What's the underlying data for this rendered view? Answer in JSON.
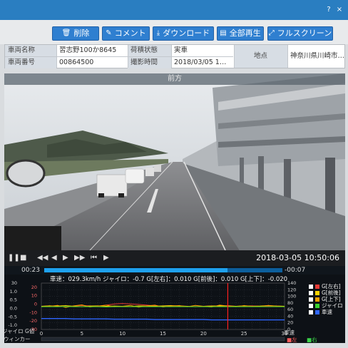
{
  "titlebar": {
    "help_label": "?",
    "close_label": "×"
  },
  "toolbar": {
    "delete": "削除",
    "comment": "コメント",
    "download": "ダウンロード",
    "play_all": "全部再生",
    "fullscreen": "フルスクリーン"
  },
  "info": {
    "vehicle_name_label": "車両名称",
    "vehicle_name": "習志野100か8645",
    "cargo_label": "荷積状態",
    "cargo": "実車",
    "vehicle_no_label": "車両番号",
    "vehicle_no": "00864500",
    "shot_time_label": "撮影時間",
    "shot_time": "2018/03/05 1…",
    "location_label": "地点",
    "location": "神奈川県川崎市…"
  },
  "video": {
    "view_label": "前方"
  },
  "player": {
    "datetime": "2018-03-05 10:50:06",
    "elapsed": "00:23",
    "remaining": "-00:07",
    "progress": 0.77
  },
  "readout": {
    "speed_label": "車速：",
    "speed": "029.3km/h",
    "gyro_label": "ジャイロ：",
    "gyro": "-0.7",
    "glr_label": "G[左右]：",
    "glr": "0.010",
    "gfb_label": "G[前後]：",
    "gfb": "0.010",
    "gud_label": "G[上下]：",
    "gud": "-0.020"
  },
  "legend": [
    {
      "label": "G[左右]",
      "color": "#e53935"
    },
    {
      "label": "G[前後]",
      "color": "#ffd400"
    },
    {
      "label": "G[上下]",
      "color": "#f5a000"
    },
    {
      "label": "ジャイロ",
      "color": "#39d12f"
    },
    {
      "label": "車速",
      "color": "#2f66ff"
    }
  ],
  "graph_labels": {
    "gyro_g": "ジャイロ  G値",
    "winker": "ウィンカー",
    "speed": "車速",
    "left": "左",
    "right": "右"
  },
  "chart_data": {
    "type": "line",
    "x": [
      0,
      1,
      2,
      3,
      4,
      5,
      6,
      7,
      8,
      9,
      10,
      11,
      12,
      13,
      14,
      15,
      16,
      17,
      18,
      19,
      20,
      21,
      22,
      23,
      24,
      25,
      26,
      27,
      28,
      29,
      30
    ],
    "x_ticks": [
      "0",
      "5",
      "10",
      "15",
      "20",
      "25",
      "30"
    ],
    "xlim": [
      0,
      30
    ],
    "y_left_ticks": [
      "30",
      "20",
      "1.0",
      "10",
      "0.5",
      "0",
      "0.0",
      "-10",
      "-0.5",
      "-20",
      "-1.0",
      "-30"
    ],
    "y_right_ticks": [
      "140",
      "120",
      "100",
      "80",
      "60",
      "40",
      "20",
      "0"
    ],
    "ylim_left": [
      -1.0,
      1.0
    ],
    "ylim_right": [
      0,
      140
    ],
    "cursor_x": 23,
    "series": [
      {
        "name": "G[左右]",
        "axis": "left",
        "values": [
          0.0,
          0.02,
          0.0,
          -0.02,
          0.01,
          0.03,
          0.02,
          0.0,
          0.05,
          0.1,
          0.12,
          0.1,
          0.08,
          0.05,
          0.02,
          0.0,
          0.0,
          0.02,
          0.0,
          -0.01,
          0.0,
          0.02,
          0.0,
          0.03,
          0.0,
          0.01,
          0.02,
          0.0,
          0.0,
          0.01,
          0.0
        ]
      },
      {
        "name": "G[前後]",
        "axis": "left",
        "values": [
          0.0,
          0.02,
          0.01,
          0.03,
          0.0,
          -0.02,
          0.01,
          0.02,
          0.0,
          0.01,
          0.0,
          -0.01,
          0.02,
          0.01,
          0.0,
          0.02,
          0.03,
          0.01,
          0.0,
          -0.02,
          0.0,
          0.01,
          0.02,
          0.01,
          0.0,
          0.02,
          0.0,
          0.01,
          0.03,
          0.01,
          0.0
        ]
      },
      {
        "name": "G[上下]",
        "axis": "left",
        "values": [
          -0.02,
          0.0,
          0.04,
          -0.05,
          0.02,
          0.06,
          -0.03,
          0.01,
          0.05,
          -0.02,
          0.0,
          0.04,
          -0.04,
          0.02,
          0.05,
          -0.03,
          0.01,
          0.03,
          -0.02,
          0.04,
          0.0,
          -0.03,
          0.05,
          0.01,
          -0.02,
          0.03,
          0.0,
          -0.01,
          0.04,
          0.0,
          -0.02
        ]
      },
      {
        "name": "ジャイロ",
        "axis": "left",
        "values": [
          -0.02,
          -0.02,
          -0.02,
          -0.01,
          -0.02,
          -0.02,
          -0.02,
          -0.02,
          -0.03,
          -0.02,
          -0.02,
          -0.02,
          -0.02,
          -0.02,
          -0.02,
          -0.02,
          -0.02,
          -0.02,
          -0.02,
          -0.02,
          -0.02,
          -0.02,
          -0.02,
          -0.02,
          -0.02,
          -0.02,
          -0.02,
          -0.02,
          -0.02,
          -0.02,
          -0.02
        ]
      },
      {
        "name": "車速",
        "axis": "right",
        "values": [
          33,
          33,
          33,
          33,
          32,
          32,
          32,
          32,
          32,
          31,
          31,
          31,
          31,
          31,
          30,
          30,
          30,
          30,
          30,
          30,
          30,
          29,
          29,
          29,
          29,
          29,
          29,
          29,
          29,
          29,
          29
        ]
      }
    ]
  }
}
